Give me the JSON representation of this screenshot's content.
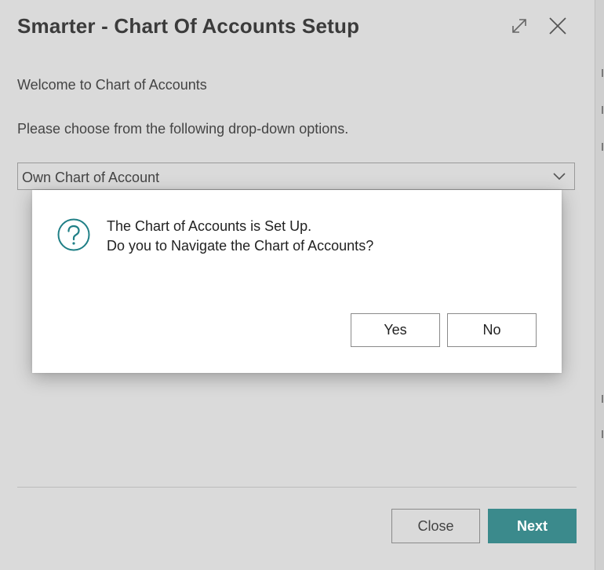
{
  "wizard": {
    "title": "Smarter - Chart Of Accounts Setup",
    "welcome_text": "Welcome to Chart of Accounts",
    "instruction_text": "Please choose from the following drop-down options.",
    "dropdown": {
      "selected_value": "Own Chart of Account"
    },
    "buttons": {
      "close_label": "Close",
      "next_label": "Next"
    },
    "icons": {
      "expand": "expand-icon",
      "close": "close-icon",
      "dropdown": "chevron-down-icon"
    }
  },
  "dialog": {
    "message_line1": "The Chart of Accounts is Set Up.",
    "message_line2": "Do you to Navigate the Chart of Accounts?",
    "icon": "question-icon",
    "buttons": {
      "yes_label": "Yes",
      "no_label": "No"
    }
  },
  "colors": {
    "accent": "#3b8a8c",
    "question_icon": "#1f7f86",
    "backdrop": "#dadada"
  }
}
